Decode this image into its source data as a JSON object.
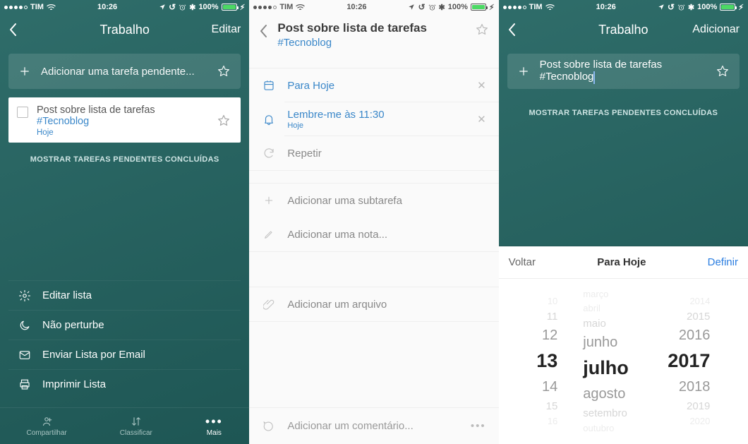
{
  "status": {
    "carrier": "TIM",
    "time": "10:26",
    "battery": "100%"
  },
  "screen1": {
    "nav_title": "Trabalho",
    "nav_action": "Editar",
    "add_placeholder": "Adicionar uma tarefa pendente...",
    "task_title_pre": "Post sobre lista de tarefas ",
    "task_hashtag": "#Tecnoblog",
    "task_date": "Hoje",
    "show_completed": "MOSTRAR TAREFAS PENDENTES CONCLUÍDAS",
    "menu": {
      "edit_list": "Editar lista",
      "dnd": "Não perturbe",
      "email": "Enviar Lista por Email",
      "print": "Imprimir Lista"
    },
    "tabs": {
      "share": "Compartilhar",
      "sort": "Classificar",
      "more": "Mais"
    }
  },
  "screen2": {
    "title": "Post sobre lista de tarefas",
    "hashtag": "#Tecnoblog",
    "due_today": "Para Hoje",
    "reminder": "Lembre-me às 11:30",
    "reminder_sub": "Hoje",
    "repeat": "Repetir",
    "add_subtask": "Adicionar uma subtarefa",
    "add_note": "Adicionar uma nota...",
    "add_file": "Adicionar um arquivo",
    "add_comment": "Adicionar um comentário..."
  },
  "screen3": {
    "nav_title": "Trabalho",
    "nav_action": "Adicionar",
    "input_text": "Post sobre lista de tarefas #Tecnoblog",
    "show_completed": "MOSTRAR TAREFAS PENDENTES CONCLUÍDAS",
    "picker": {
      "back": "Voltar",
      "title": "Para Hoje",
      "set": "Definir",
      "days": [
        "10",
        "11",
        "12",
        "13",
        "14",
        "15",
        "16"
      ],
      "months": [
        "março",
        "abril",
        "maio",
        "junho",
        "julho",
        "agosto",
        "setembro",
        "outubro"
      ],
      "years": [
        "2014",
        "2015",
        "2016",
        "2017",
        "2018",
        "2019",
        "2020"
      ]
    }
  },
  "chart_data": {
    "type": "table",
    "title": "Date picker selection",
    "selected": {
      "day": 13,
      "month": "julho",
      "year": 2017
    },
    "visible_days": [
      10,
      11,
      12,
      13,
      14,
      15,
      16
    ],
    "visible_months": [
      "março",
      "abril",
      "maio",
      "junho",
      "julho",
      "agosto",
      "setembro",
      "outubro"
    ],
    "visible_years": [
      2014,
      2015,
      2016,
      2017,
      2018,
      2019,
      2020
    ]
  }
}
